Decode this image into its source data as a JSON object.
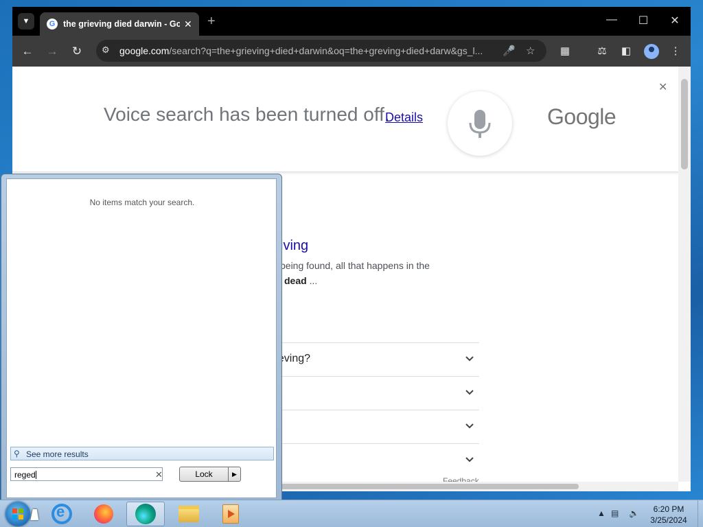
{
  "browser": {
    "tab_title": "the grieving died darwin - Goo",
    "tab_favicon": "G",
    "url_host": "google.com",
    "url_rest": "/search?q=the+grieving+died+darwin&oq=the+greving+died+darw&gs_l...",
    "accent": "#3c3c3c"
  },
  "voice_banner": {
    "message": "Voice search has been turned off.",
    "details_link": "Details",
    "logo": "Google"
  },
  "results": {
    "link_fragment": "iving",
    "snippet_line1": "being found, all that happens in the",
    "snippet_bold": "dead",
    "snippet_tail": " ...",
    "paa": [
      {
        "q": "rieving?"
      },
      {
        "q": ""
      },
      {
        "q": ""
      },
      {
        "q": ""
      }
    ],
    "feedback": "Feedback"
  },
  "start_menu": {
    "no_items": "No items match your search.",
    "see_more": "See more results",
    "search_value": "reged",
    "lock_label": "Lock"
  },
  "taskbar": {
    "apps": [
      "internet-explorer",
      "firefox",
      "edge",
      "file-explorer",
      "media-player"
    ],
    "time": "6:20 PM",
    "date": "3/25/2024"
  }
}
